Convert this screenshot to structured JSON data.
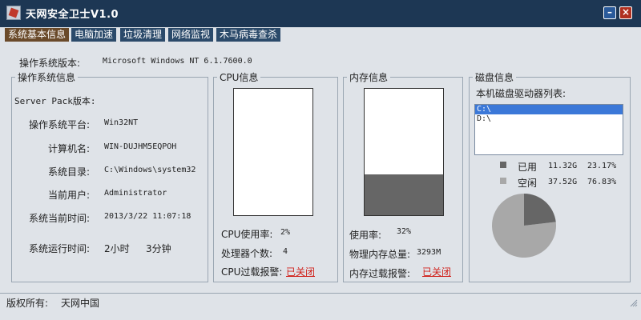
{
  "window": {
    "title": "天网安全卫士V1.0",
    "minimize": "–",
    "close": "×"
  },
  "tabs": [
    {
      "label": "系统基本信息",
      "active": true
    },
    {
      "label": "电脑加速",
      "active": false
    },
    {
      "label": "垃圾清理",
      "active": false
    },
    {
      "label": "网络监视",
      "active": false
    },
    {
      "label": "木马病毒查杀",
      "active": false
    }
  ],
  "os": {
    "version_label": "操作系统版本:",
    "version_value": "Microsoft Windows NT 6.1.7600.0",
    "group_title": "操作系统信息",
    "server_pack_label": "Server Pack版本:",
    "platform_label": "操作系统平台:",
    "platform_value": "Win32NT",
    "computer_label": "计算机名:",
    "computer_value": "WIN-DUJHM5EQPOH",
    "sysdir_label": "系统目录:",
    "sysdir_value": "C:\\Windows\\system32",
    "user_label": "当前用户:",
    "user_value": "Administrator",
    "time_label": "系统当前时间:",
    "time_value": "2013/3/22 11:07:18",
    "uptime_label": "系统运行时间:",
    "uptime_hours": "2小时",
    "uptime_minutes": "3分钟"
  },
  "cpu": {
    "group_title": "CPU信息",
    "usage_label": "CPU使用率:",
    "usage_value": "2%",
    "usage_fraction": 0.0,
    "count_label": "处理器个数:",
    "count_value": "4",
    "alarm_label": "CPU过载报警:",
    "alarm_value": "已关闭"
  },
  "memory": {
    "group_title": "内存信息",
    "usage_label": "使用率:",
    "usage_value": "32%",
    "usage_fraction": 0.32,
    "total_label": "物理内存总量:",
    "total_value": "3293M",
    "alarm_label": "内存过载报警:",
    "alarm_value": "已关闭"
  },
  "disk": {
    "group_title": "磁盘信息",
    "list_label": "本机磁盘驱动器列表:",
    "drives": [
      {
        "name": "C:\\",
        "selected": true
      },
      {
        "name": "D:\\",
        "selected": false
      }
    ],
    "used_label": "已用",
    "used_size": "11.32G",
    "used_percent": "23.17%",
    "free_label": "空闲",
    "free_size": "37.52G",
    "free_percent": "76.83%",
    "used_fraction": 0.2317,
    "used_color": "#666666",
    "free_color": "#a8a8a8"
  },
  "status": {
    "copyright_label": "版权所有:",
    "owner": "天网中国"
  }
}
